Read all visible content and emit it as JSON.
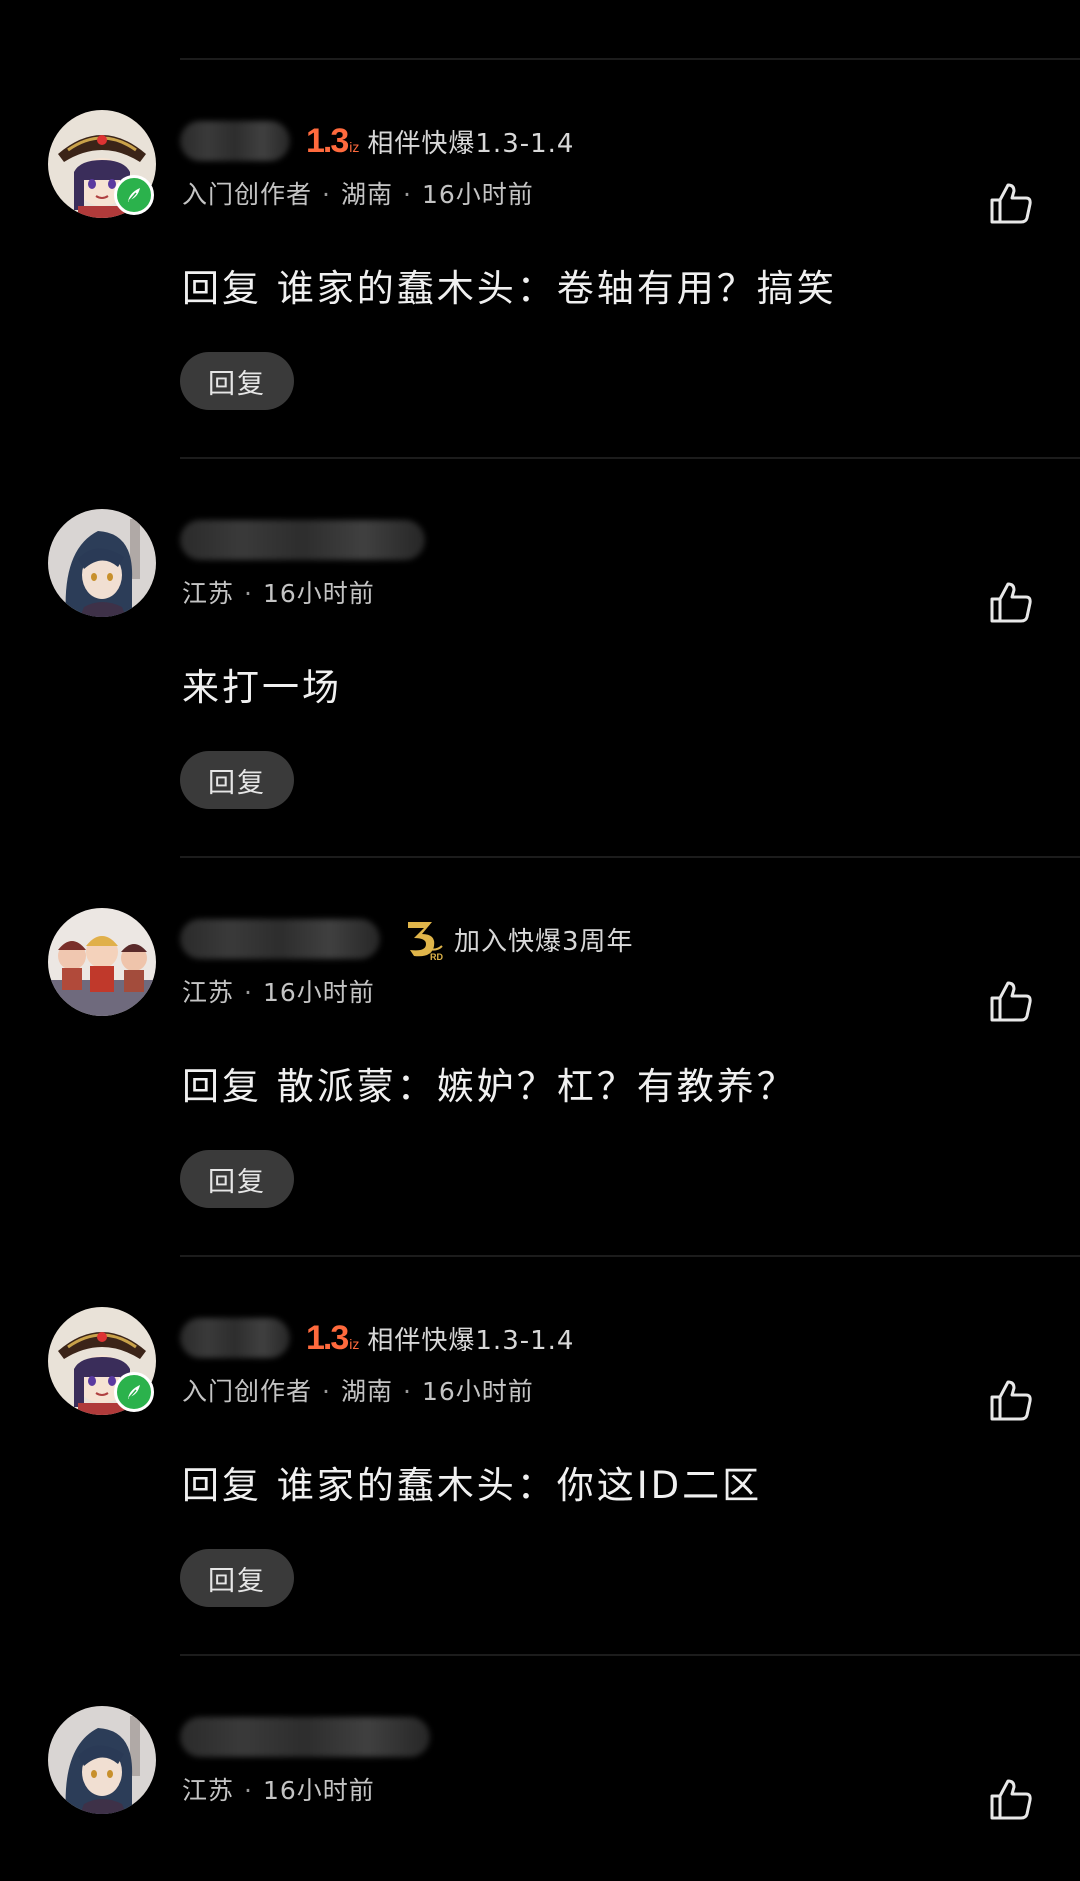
{
  "comments": [
    {
      "avatar": "anime-girl-hat-avatar",
      "has_creator_badge": true,
      "badge": {
        "kind": "version",
        "num": "1.3",
        "unit": "iz",
        "text": "相伴快爆1.3-1.4"
      },
      "meta": {
        "role": "入门创作者",
        "location": "湖南",
        "time": "16小时前"
      },
      "text": "回复 谁家的蠢木头：卷轴有用？搞笑",
      "reply_label": "回复"
    },
    {
      "avatar": "anime-blue-hair-avatar",
      "has_creator_badge": false,
      "badge": null,
      "meta": {
        "location": "江苏",
        "time": "16小时前"
      },
      "text": "来打一场",
      "reply_label": "回复"
    },
    {
      "avatar": "figurines-avatar",
      "has_creator_badge": false,
      "badge": {
        "kind": "anniversary",
        "text": "加入快爆3周年"
      },
      "meta": {
        "location": "江苏",
        "time": "16小时前"
      },
      "text": "回复 散派蒙：嫉妒？杠？有教养？",
      "reply_label": "回复"
    },
    {
      "avatar": "anime-girl-hat-avatar",
      "has_creator_badge": true,
      "badge": {
        "kind": "version",
        "num": "1.3",
        "unit": "iz",
        "text": "相伴快爆1.3-1.4"
      },
      "meta": {
        "role": "入门创作者",
        "location": "湖南",
        "time": "16小时前"
      },
      "text": "回复 谁家的蠢木头：你这ID二区",
      "reply_label": "回复"
    },
    {
      "avatar": "anime-blue-hair-avatar",
      "has_creator_badge": false,
      "badge": null,
      "meta": {
        "location": "江苏",
        "time": "16小时前"
      },
      "text": "",
      "reply_label": ""
    }
  ],
  "colors": {
    "background": "#000000",
    "version_badge": "#ff6a3d",
    "creator_badge": "#2bb24c",
    "reply_button_bg": "#3a3a3a"
  }
}
